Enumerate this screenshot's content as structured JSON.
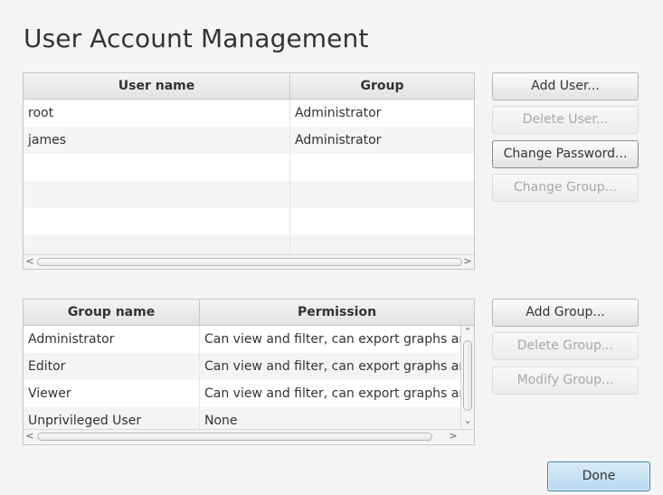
{
  "title": "User Account Management",
  "users_table": {
    "headers": [
      "User name",
      "Group"
    ],
    "rows": [
      [
        "root",
        "Administrator"
      ],
      [
        "james",
        "Administrator"
      ]
    ]
  },
  "user_buttons": {
    "add": "Add User...",
    "delete": "Delete User...",
    "change_password": "Change Password...",
    "change_group": "Change Group..."
  },
  "groups_table": {
    "headers": [
      "Group name",
      "Permission"
    ],
    "rows": [
      [
        "Administrator",
        "Can view and filter, can export graphs and"
      ],
      [
        "Editor",
        "Can view and filter, can export graphs and"
      ],
      [
        "Viewer",
        "Can view and filter, can export graphs and"
      ],
      [
        "Unprivileged User",
        "None"
      ]
    ]
  },
  "group_buttons": {
    "add": "Add Group...",
    "delete": "Delete Group...",
    "modify": "Modify Group..."
  },
  "done_label": "Done",
  "scroll_glyphs": {
    "left": "<",
    "right": ">",
    "up": "⌃",
    "down": "⌄"
  }
}
